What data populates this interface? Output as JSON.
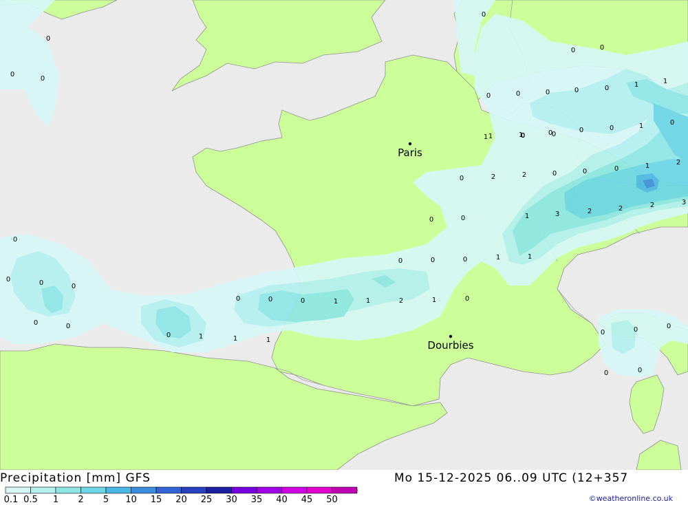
{
  "title": "Precipitation [mm] GFS",
  "valid_time": "Mo 15-12-2025 06..09 UTC (12+357",
  "credit": "©weatheronline.co.uk",
  "colors": {
    "sea": "#ebebeb",
    "land": "#ccff99",
    "border": "#a0a0a0",
    "coast": "#909090"
  },
  "legend": {
    "labels": [
      "0.1",
      "0.5",
      "1",
      "2",
      "5",
      "10",
      "15",
      "20",
      "25",
      "30",
      "35",
      "40",
      "45",
      "50"
    ],
    "colors": [
      "#d7f7f7",
      "#b4f0f0",
      "#8ee6e6",
      "#6cd6e6",
      "#4cb8e6",
      "#3c8ee0",
      "#3264d8",
      "#2640c0",
      "#1a20a0",
      "#7800e0",
      "#a000e6",
      "#d000e6",
      "#e600d0",
      "#c000b0"
    ]
  },
  "cities": [
    {
      "name": "Paris"
    },
    {
      "name": "Dourbies"
    }
  ],
  "value_labels": [
    "0",
    "0",
    "0",
    "0",
    "0",
    "0",
    "0",
    "0",
    "0",
    "0",
    "0",
    "1",
    "1",
    "1",
    "1",
    "0",
    "0",
    "0",
    "1",
    "0",
    "0",
    "2",
    "2",
    "0",
    "0",
    "0",
    "1",
    "2",
    "1",
    "3",
    "2",
    "2",
    "2",
    "3",
    "1",
    "1",
    "0",
    "0",
    "0",
    "0",
    "0",
    "0",
    "0",
    "0",
    "0",
    "0",
    "0",
    "1",
    "0",
    "1",
    "0",
    "1",
    "1",
    "2",
    "1",
    "0",
    "0",
    "0",
    "0",
    "0",
    "0",
    "0",
    "0",
    "1",
    "1",
    "0",
    "0",
    "0",
    "0",
    "0",
    "0"
  ]
}
